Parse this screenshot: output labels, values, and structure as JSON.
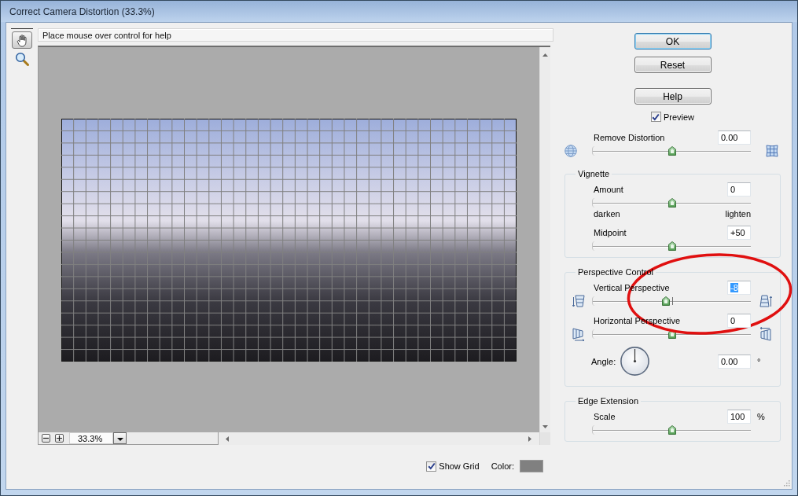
{
  "window": {
    "title": "Correct Camera Distortion (33.3%)"
  },
  "tools": [
    {
      "kind": "hand",
      "selected": true
    },
    {
      "kind": "zoom",
      "selected": false
    }
  ],
  "help_text": "Place mouse over control for help",
  "preview": {
    "zoom_value": "33.3%"
  },
  "buttons": [
    {
      "label": "OK",
      "default": true
    },
    {
      "label": "Reset",
      "default": false
    }
  ],
  "help_button": {
    "label": "Help"
  },
  "preview_checkbox": {
    "label": "Preview",
    "checked": true
  },
  "remove_distortion": {
    "kind": "distortion",
    "label": "Remove Distortion",
    "value": "0.00",
    "text_selected": false,
    "level": 0.5
  },
  "groups": [
    {
      "title": "Vignette",
      "rows": [
        {
          "kind": "plain",
          "label": "Amount",
          "value": "0",
          "text_selected": false,
          "level": 0.5
        },
        {
          "kind": "range",
          "left": "darken",
          "right": "lighten"
        },
        {
          "kind": "plain",
          "label": "Midpoint",
          "value": "+50",
          "text_selected": false,
          "level": 0.5
        }
      ]
    },
    {
      "title": "Perspective Control",
      "rows": [
        {
          "kind": "vertical",
          "label": "Vertical Perspective",
          "value": "-8",
          "text_selected": true,
          "level": 0.465
        },
        {
          "kind": "horizontal",
          "label": "Horizontal Perspective",
          "value": "0",
          "text_selected": false,
          "level": 0.5
        },
        {
          "kind": "angle",
          "label": "Angle:",
          "value": "0.00",
          "text_selected": false,
          "unit": "°"
        }
      ]
    },
    {
      "title": "Edge Extension",
      "rows": [
        {
          "kind": "plain",
          "label": "Scale",
          "value": "100",
          "text_selected": false,
          "unit": "%",
          "level": 0.5
        }
      ]
    }
  ],
  "show_grid": {
    "label": "Show Grid",
    "checked": true
  },
  "grid_color": {
    "label": "Color:",
    "color": "#808080"
  }
}
